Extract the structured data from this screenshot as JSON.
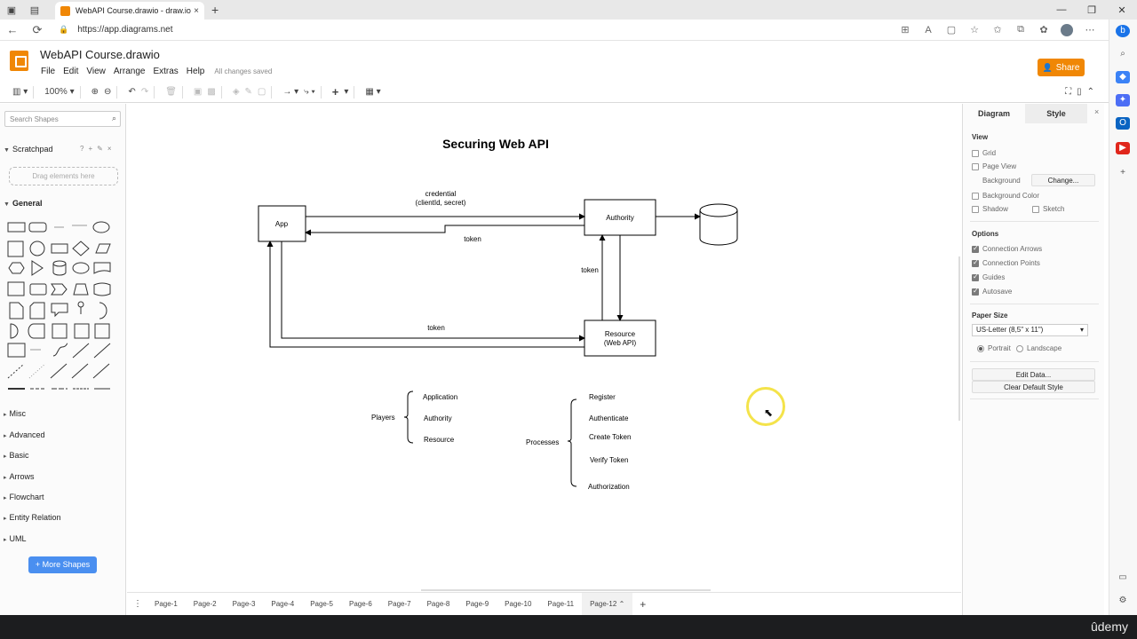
{
  "browser": {
    "tab_title": "WebAPI Course.drawio - draw.io",
    "tab_close": "×",
    "new_tab": "+",
    "url": "https://app.diagrams.net",
    "window_controls": [
      "—",
      "❐",
      "✕"
    ]
  },
  "app": {
    "doc_title": "WebAPI Course.drawio",
    "menus": [
      "File",
      "Edit",
      "View",
      "Arrange",
      "Extras",
      "Help"
    ],
    "save_status": "All changes saved",
    "share_label": "Share",
    "zoom": "100%"
  },
  "left_panel": {
    "search_placeholder": "Search Shapes",
    "scratchpad": "Scratchpad",
    "drag_hint": "Drag elements here",
    "general": "General",
    "sections": [
      "Misc",
      "Advanced",
      "Basic",
      "Arrows",
      "Flowchart",
      "Entity Relation",
      "UML"
    ],
    "more_shapes": "+ More Shapes"
  },
  "diagram": {
    "title": "Securing Web API",
    "app_box": "App",
    "authority_box": "Authority",
    "resource_line1": "Resource",
    "resource_line2": "(Web API)",
    "credential_line1": "credential",
    "credential_line2": "(clientId, secret)",
    "token_top": "token",
    "token_mid": "token",
    "token_bottom": "token",
    "players_label": "Players",
    "players": [
      "Application",
      "Authority",
      "Resource"
    ],
    "processes_label": "Processes",
    "processes": [
      "Register",
      "Authenticate",
      "Create Token",
      "Verify Token",
      "Authorization"
    ]
  },
  "right_panel": {
    "tab_diagram": "Diagram",
    "tab_style": "Style",
    "close": "×",
    "view_label": "View",
    "grid": "Grid",
    "page_view": "Page View",
    "background": "Background",
    "change_btn": "Change...",
    "background_color": "Background Color",
    "shadow": "Shadow",
    "sketch": "Sketch",
    "options_label": "Options",
    "connection_arrows": "Connection Arrows",
    "connection_points": "Connection Points",
    "guides": "Guides",
    "autosave": "Autosave",
    "paper_size_label": "Paper Size",
    "paper_size": "US-Letter (8,5\" x 11\")",
    "portrait": "Portrait",
    "landscape": "Landscape",
    "edit_data": "Edit Data...",
    "clear_default_style": "Clear Default Style"
  },
  "pages": [
    "Page-1",
    "Page-2",
    "Page-3",
    "Page-4",
    "Page-5",
    "Page-6",
    "Page-7",
    "Page-8",
    "Page-9",
    "Page-10",
    "Page-11",
    "Page-12"
  ],
  "active_page": "Page-12",
  "udemy": "ûdemy",
  "colors": {
    "accent_orange": "#f08705",
    "more_shapes_blue": "#4a8ff0",
    "cursor_ring": "#f4e34a"
  }
}
